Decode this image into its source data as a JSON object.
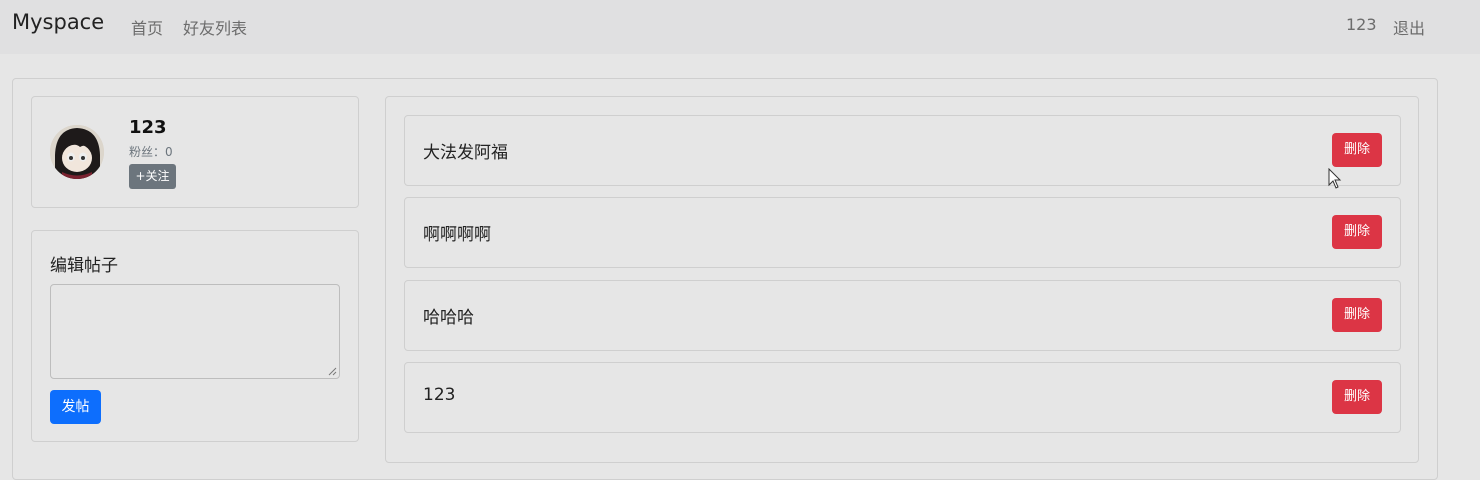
{
  "navbar": {
    "brand": "Myspace",
    "links": [
      "首页",
      "好友列表"
    ],
    "user": "123",
    "logout": "退出"
  },
  "profile": {
    "avatar_icon": "user-avatar",
    "username": "123",
    "fans_label": "粉丝：0",
    "follow_label": "+关注"
  },
  "editor": {
    "title": "编辑帖子",
    "textarea_value": "",
    "submit_label": "发帖"
  },
  "posts": [
    {
      "content": "大法发阿福",
      "delete_label": "删除"
    },
    {
      "content": "啊啊啊啊",
      "delete_label": "删除"
    },
    {
      "content": "哈哈哈",
      "delete_label": "删除"
    },
    {
      "content": "123",
      "delete_label": "删除"
    }
  ],
  "colors": {
    "primary": "#0d6efd",
    "danger": "#dc3545",
    "secondary": "#6c757d"
  }
}
